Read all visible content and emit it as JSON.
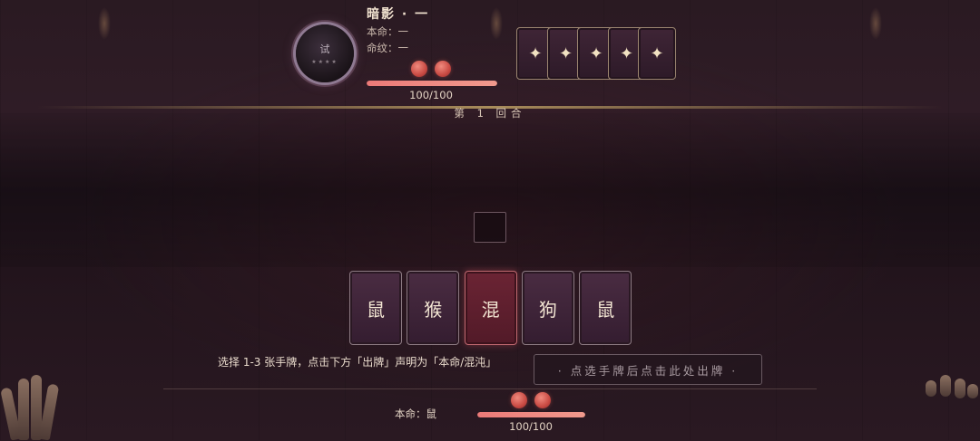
{
  "opponent": {
    "avatar_text": "试",
    "avatar_stars": "★★★★",
    "name": "暗影 · 一",
    "benming": "本命：一",
    "mingwen": "命纹：一",
    "hp_text": "100/100",
    "hp_fraction": 1.0,
    "beads": 2,
    "deck_cards": [
      "✦",
      "✦",
      "✦",
      "✦",
      "✦"
    ]
  },
  "round_text": "第 1 回合",
  "hand": [
    {
      "label": "鼠",
      "selected": false
    },
    {
      "label": "猴",
      "selected": false
    },
    {
      "label": "混",
      "selected": true
    },
    {
      "label": "狗",
      "selected": false
    },
    {
      "label": "鼠",
      "selected": false
    }
  ],
  "instruction": "选择 1-3 张手牌，点击下方「出牌」声明为「本命/混沌」",
  "play_button": "· 点选手牌后点击此处出牌 ·",
  "player": {
    "benming": "本命：鼠",
    "hp_text": "100/100",
    "hp_fraction": 1.0,
    "beads": 2
  },
  "colors": {
    "bead": "#d0514a",
    "hp_fill": "#ec7a78",
    "selected_card": "#6b2434"
  }
}
